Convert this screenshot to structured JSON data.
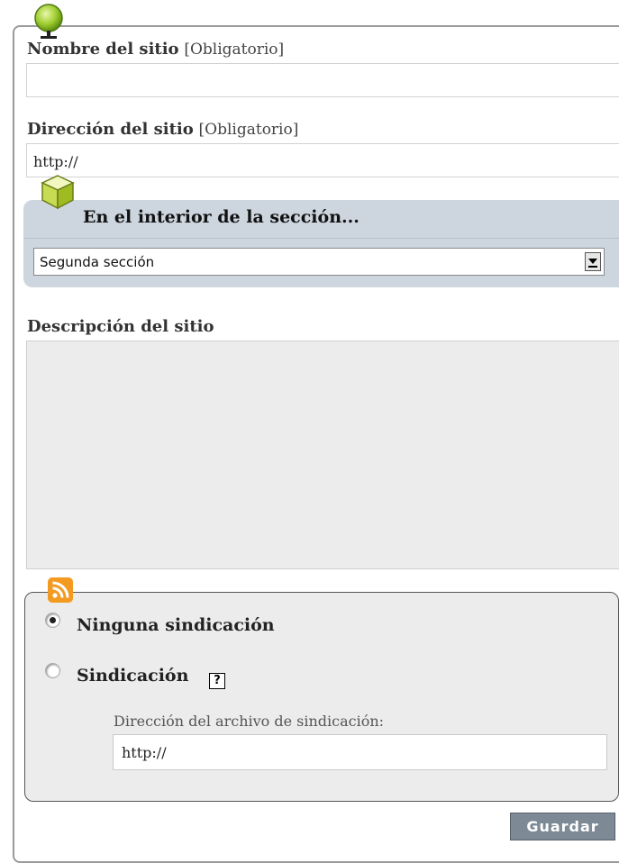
{
  "site_name": {
    "label": "Nombre del sitio",
    "required": "[Obligatorio]",
    "value": ""
  },
  "site_url": {
    "label": "Dirección del sitio",
    "required": "[Obligatorio]",
    "value": "http://"
  },
  "section": {
    "title": "En el interior de la sección...",
    "selected": "Segunda sección"
  },
  "description": {
    "label": "Descripción del sitio",
    "value": ""
  },
  "syndication": {
    "option_none": "Ninguna sindicación",
    "option_syndication": "Sindicación",
    "selected": "none",
    "help_icon": "?",
    "feed_label": "Dirección del archivo de sindicación:",
    "feed_value": "http://"
  },
  "actions": {
    "save_label": "Guardar"
  },
  "colors": {
    "section_bg": "#cdd6df",
    "button_bg": "#7d8a96",
    "rss_orange": "#f39a21"
  }
}
